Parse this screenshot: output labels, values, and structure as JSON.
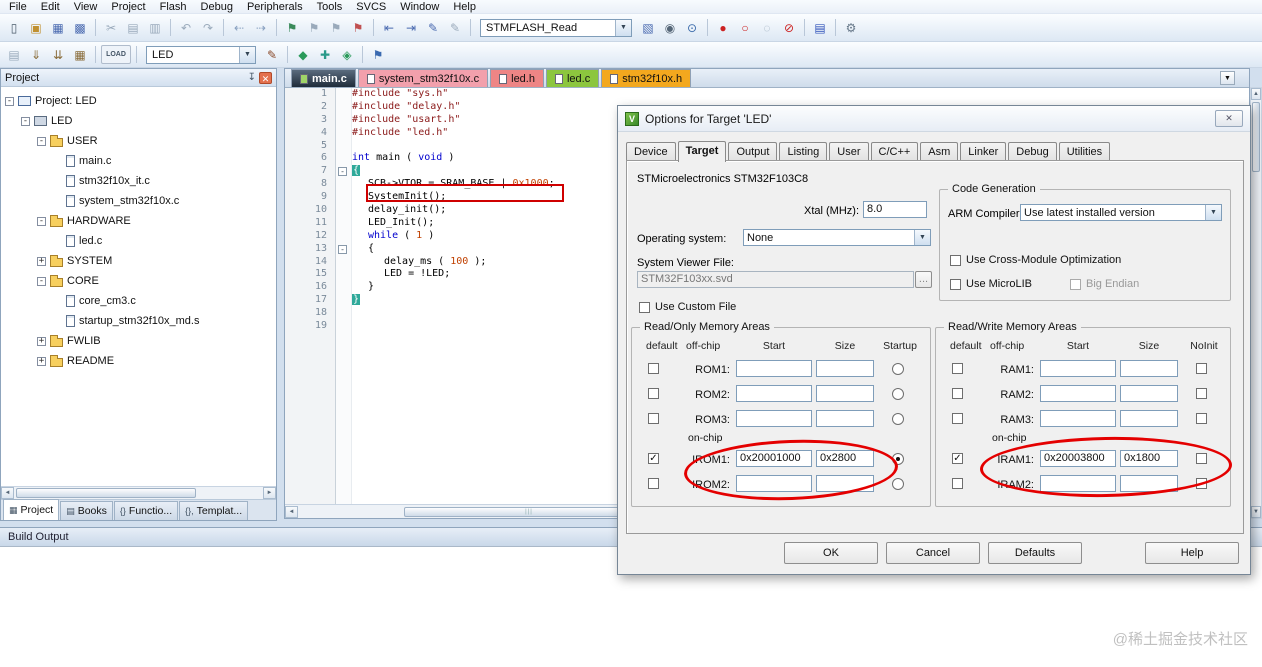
{
  "glyphs": {
    "dropdown": "▼",
    "check": "✓",
    "close": "✕",
    "left": "◄",
    "right": "►",
    "up": "▲",
    "down": "▼",
    "pin": "↧",
    "grip": "|||",
    "plus": "+",
    "minus": "-",
    "logo": "V"
  },
  "menubar": {
    "items": [
      "File",
      "Edit",
      "View",
      "Project",
      "Flash",
      "Debug",
      "Peripherals",
      "Tools",
      "SVCS",
      "Window",
      "Help"
    ]
  },
  "toolbar1": {
    "icons_left": [
      {
        "n": "new-file-icon",
        "g": "▯",
        "c": "#4a5a6a"
      },
      {
        "n": "open-folder-icon",
        "g": "▣",
        "c": "#c09030"
      },
      {
        "n": "save-icon",
        "g": "▦",
        "c": "#4a6ab0"
      },
      {
        "n": "save-all-icon",
        "g": "▩",
        "c": "#4a6ab0"
      },
      {
        "sep": true
      },
      {
        "n": "cut-icon",
        "g": "✂",
        "c": "#9aaabb"
      },
      {
        "n": "copy-icon",
        "g": "▤",
        "c": "#9aaabb"
      },
      {
        "n": "paste-icon",
        "g": "▥",
        "c": "#9aaabb"
      },
      {
        "sep": true
      },
      {
        "n": "undo-icon",
        "g": "↶",
        "c": "#9aaabb"
      },
      {
        "n": "redo-icon",
        "g": "↷",
        "c": "#9aaabb"
      },
      {
        "sep": true
      },
      {
        "n": "nav-back-icon",
        "g": "⇠",
        "c": "#88a0c0"
      },
      {
        "n": "nav-forward-icon",
        "g": "⇢",
        "c": "#88a0c0"
      },
      {
        "sep": true
      },
      {
        "n": "bookmark-toggle-icon",
        "g": "⚑",
        "c": "#3a8a5a"
      },
      {
        "n": "bookmark-prev-icon",
        "g": "⚑",
        "c": "#9aaabb"
      },
      {
        "n": "bookmark-next-icon",
        "g": "⚑",
        "c": "#9aaabb"
      },
      {
        "n": "bookmark-clear-icon",
        "g": "⚑",
        "c": "#c05050"
      },
      {
        "sep": true
      },
      {
        "n": "unindent-icon",
        "g": "⇤",
        "c": "#4a6ab0"
      },
      {
        "n": "indent-icon",
        "g": "⇥",
        "c": "#4a6ab0"
      },
      {
        "n": "comment-icon",
        "g": "✎",
        "c": "#4a6ab0"
      },
      {
        "n": "uncomment-icon",
        "g": "✎",
        "c": "#9aaabb"
      },
      {
        "sep": true
      }
    ],
    "find_combo": "STMFLASH_Read",
    "icons_right": [
      {
        "n": "find-in-files-icon",
        "g": "▧",
        "c": "#4a6ab0"
      },
      {
        "n": "find-icon",
        "g": "◉",
        "c": "#556677"
      },
      {
        "n": "search-icon",
        "g": "⊙",
        "c": "#3a6aaa"
      },
      {
        "sep": true
      },
      {
        "n": "breakpoint-icon",
        "g": "●",
        "c": "#cc2222"
      },
      {
        "n": "breakpoint-disable-icon",
        "g": "○",
        "c": "#cc2222"
      },
      {
        "n": "breakpoint-disable-all-icon",
        "g": "◌",
        "c": "#99aabb"
      },
      {
        "n": "breakpoint-kill-all-icon",
        "g": "⊘",
        "c": "#cc2222"
      },
      {
        "sep": true
      },
      {
        "n": "watch-window-icon",
        "g": "▤",
        "c": "#3355bb"
      },
      {
        "sep": true
      },
      {
        "n": "configure-icon",
        "g": "⚙",
        "c": "#667788"
      }
    ]
  },
  "toolbar2": {
    "icons_left": [
      {
        "n": "translate-file-icon",
        "g": "▤",
        "c": "#99aabb"
      },
      {
        "n": "build-icon",
        "g": "⇓",
        "c": "#8a6d3b"
      },
      {
        "n": "rebuild-all-icon",
        "g": "⇊",
        "c": "#8a6d3b"
      },
      {
        "n": "batch-build-icon",
        "g": "▦",
        "c": "#8a6d3b"
      },
      {
        "sep": true
      },
      {
        "n": "download-icon",
        "g": "LOAD",
        "c": "#445566",
        "wide": true
      },
      {
        "sep": true
      }
    ],
    "target_combo": "LED",
    "icons_right": [
      {
        "n": "target-options-icon",
        "g": "✎",
        "c": "#8a4a2a"
      },
      {
        "sep": true
      },
      {
        "n": "manage-rte-icon",
        "g": "◆",
        "c": "#2a9a5a"
      },
      {
        "n": "pack-installer-icon",
        "g": "✚",
        "c": "#2a9a8a"
      },
      {
        "n": "boards-icon",
        "g": "◈",
        "c": "#2a9a5a"
      },
      {
        "sep": true
      },
      {
        "n": "flag-icon",
        "g": "⚑",
        "c": "#3a6ab0"
      }
    ]
  },
  "project_panel": {
    "title": "Project",
    "tree": [
      {
        "label": "Project: LED",
        "level": 0,
        "expand": "minus",
        "icon": "workspace"
      },
      {
        "label": "LED",
        "level": 1,
        "expand": "minus",
        "icon": "target"
      },
      {
        "label": "USER",
        "level": 2,
        "expand": "minus",
        "icon": "folder"
      },
      {
        "label": "main.c",
        "level": 3,
        "icon": "file"
      },
      {
        "label": "stm32f10x_it.c",
        "level": 3,
        "icon": "file"
      },
      {
        "label": "system_stm32f10x.c",
        "level": 3,
        "icon": "file"
      },
      {
        "label": "HARDWARE",
        "level": 2,
        "expand": "minus",
        "icon": "folder"
      },
      {
        "label": "led.c",
        "level": 3,
        "icon": "file"
      },
      {
        "label": "SYSTEM",
        "level": 2,
        "expand": "plus",
        "icon": "folder"
      },
      {
        "label": "CORE",
        "level": 2,
        "expand": "minus",
        "icon": "folder"
      },
      {
        "label": "core_cm3.c",
        "level": 3,
        "icon": "file"
      },
      {
        "label": "startup_stm32f10x_md.s",
        "level": 3,
        "icon": "file"
      },
      {
        "label": "FWLIB",
        "level": 2,
        "expand": "plus",
        "icon": "folder"
      },
      {
        "label": "README",
        "level": 2,
        "expand": "plus",
        "icon": "folder"
      }
    ],
    "bottom_tabs": [
      {
        "icon": "▦",
        "label": "Project",
        "active": true
      },
      {
        "icon": "▤",
        "label": "Books"
      },
      {
        "icon": "{}",
        "label": "Functio..."
      },
      {
        "icon": "{},",
        "label": "Templat..."
      }
    ]
  },
  "editor": {
    "tabs": [
      {
        "label": "main.c",
        "state": "active"
      },
      {
        "label": "system_stm32f10x.c",
        "state": "pink"
      },
      {
        "label": "led.h",
        "state": "red"
      },
      {
        "label": "led.c",
        "state": "green"
      },
      {
        "label": "stm32f10x.h",
        "state": "orange"
      }
    ],
    "lines": [
      {
        "n": 1,
        "segs": [
          {
            "t": "#include ",
            "c": "pp"
          },
          {
            "t": "\"sys.h\"",
            "c": "str"
          }
        ]
      },
      {
        "n": 2,
        "segs": [
          {
            "t": "#include ",
            "c": "pp"
          },
          {
            "t": "\"delay.h\"",
            "c": "str"
          }
        ]
      },
      {
        "n": 3,
        "segs": [
          {
            "t": "#include ",
            "c": "pp"
          },
          {
            "t": "\"usart.h\"",
            "c": "str"
          }
        ]
      },
      {
        "n": 4,
        "segs": [
          {
            "t": "#include ",
            "c": "pp"
          },
          {
            "t": "\"led.h\"",
            "c": "str"
          }
        ]
      },
      {
        "n": 5,
        "segs": []
      },
      {
        "n": 6,
        "segs": [
          {
            "t": "int",
            "c": "kw"
          },
          {
            "t": " main ( ",
            "c": "plain"
          },
          {
            "t": "void",
            "c": "kw"
          },
          {
            "t": " )",
            "c": "plain"
          }
        ]
      },
      {
        "n": 7,
        "fold": true,
        "segs": [
          {
            "t": "{",
            "c": "brace"
          }
        ]
      },
      {
        "n": 8,
        "ind": 1,
        "segs": [
          {
            "t": "SCB->VTOR = SRAM_BASE | ",
            "c": "plain"
          },
          {
            "t": "0x1000",
            "c": "num"
          },
          {
            "t": ";",
            "c": "plain"
          }
        ]
      },
      {
        "n": 9,
        "ind": 1,
        "segs": [
          {
            "t": "SystemInit();",
            "c": "plain"
          }
        ]
      },
      {
        "n": 10,
        "ind": 1,
        "segs": [
          {
            "t": "delay_init();",
            "c": "plain"
          }
        ]
      },
      {
        "n": 11,
        "ind": 1,
        "segs": [
          {
            "t": "LED_Init();",
            "c": "plain"
          }
        ]
      },
      {
        "n": 12,
        "ind": 1,
        "segs": [
          {
            "t": "while",
            "c": "kw"
          },
          {
            "t": " ( ",
            "c": "plain"
          },
          {
            "t": "1",
            "c": "num"
          },
          {
            "t": " )",
            "c": "plain"
          }
        ]
      },
      {
        "n": 13,
        "ind": 1,
        "fold": true,
        "segs": [
          {
            "t": "{",
            "c": "plain"
          }
        ]
      },
      {
        "n": 14,
        "ind": 2,
        "segs": [
          {
            "t": "delay_ms ( ",
            "c": "plain"
          },
          {
            "t": "100",
            "c": "num"
          },
          {
            "t": " );",
            "c": "plain"
          }
        ]
      },
      {
        "n": 15,
        "ind": 2,
        "segs": [
          {
            "t": "LED = !LED;",
            "c": "plain"
          }
        ]
      },
      {
        "n": 16,
        "ind": 1,
        "segs": [
          {
            "t": "}",
            "c": "plain"
          }
        ]
      },
      {
        "n": 17,
        "segs": [
          {
            "t": "}",
            "c": "brace"
          }
        ]
      },
      {
        "n": 18,
        "segs": []
      },
      {
        "n": 19,
        "segs": []
      }
    ]
  },
  "dialog": {
    "title": "Options for Target 'LED'",
    "tabs": [
      "Device",
      "Target",
      "Output",
      "Listing",
      "User",
      "C/C++",
      "Asm",
      "Linker",
      "Debug",
      "Utilities"
    ],
    "active_tab": "Target",
    "device_label": "STMicroelectronics STM32F103C8",
    "xtal": {
      "label": "Xtal (MHz):",
      "value": "8.0"
    },
    "os": {
      "label": "Operating system:",
      "value": "None"
    },
    "svf": {
      "label": "System Viewer File:",
      "value": "STM32F103xx.svd",
      "browse": "..."
    },
    "use_custom_file": {
      "label": "Use Custom File",
      "checked": false
    },
    "code_gen": {
      "title": "Code Generation",
      "arm_compiler_label": "ARM Compiler:",
      "arm_compiler_value": "Use latest installed version",
      "cross_module": {
        "label": "Use Cross-Module Optimization",
        "checked": false
      },
      "microlib": {
        "label": "Use MicroLIB",
        "checked": false
      },
      "big_endian": {
        "label": "Big Endian",
        "checked": false,
        "disabled": true
      }
    },
    "rom": {
      "title": "Read/Only Memory Areas",
      "headers": [
        "default",
        "off-chip",
        "Start",
        "Size",
        "Startup"
      ],
      "rows": [
        {
          "label": "ROM1:",
          "checked": false,
          "start": "",
          "size": "",
          "radio": false
        },
        {
          "label": "ROM2:",
          "checked": false,
          "start": "",
          "size": "",
          "radio": false
        },
        {
          "label": "ROM3:",
          "checked": false,
          "start": "",
          "size": "",
          "radio": false
        }
      ],
      "onchip_label": "on-chip",
      "onchip_rows": [
        {
          "label": "IROM1:",
          "checked": true,
          "start": "0x20001000",
          "size": "0x2800",
          "radio": true
        },
        {
          "label": "IROM2:",
          "checked": false,
          "start": "",
          "size": "",
          "radio": false
        }
      ]
    },
    "ram": {
      "title": "Read/Write Memory Areas",
      "headers": [
        "default",
        "off-chip",
        "Start",
        "Size",
        "NoInit"
      ],
      "rows": [
        {
          "label": "RAM1:",
          "checked": false,
          "start": "",
          "size": "",
          "noinit": false
        },
        {
          "label": "RAM2:",
          "checked": false,
          "start": "",
          "size": "",
          "noinit": false
        },
        {
          "label": "RAM3:",
          "checked": false,
          "start": "",
          "size": "",
          "noinit": false
        }
      ],
      "onchip_label": "on-chip",
      "onchip_rows": [
        {
          "label": "IRAM1:",
          "checked": true,
          "start": "0x20003800",
          "size": "0x1800",
          "noinit": false
        },
        {
          "label": "IRAM2:",
          "checked": false,
          "start": "",
          "size": "",
          "noinit": false
        }
      ]
    },
    "buttons": [
      "OK",
      "Cancel",
      "Defaults",
      "Help"
    ]
  },
  "statusbar": {
    "label": "Build Output"
  },
  "window": {
    "watermark": "@稀土掘金技术社区"
  }
}
